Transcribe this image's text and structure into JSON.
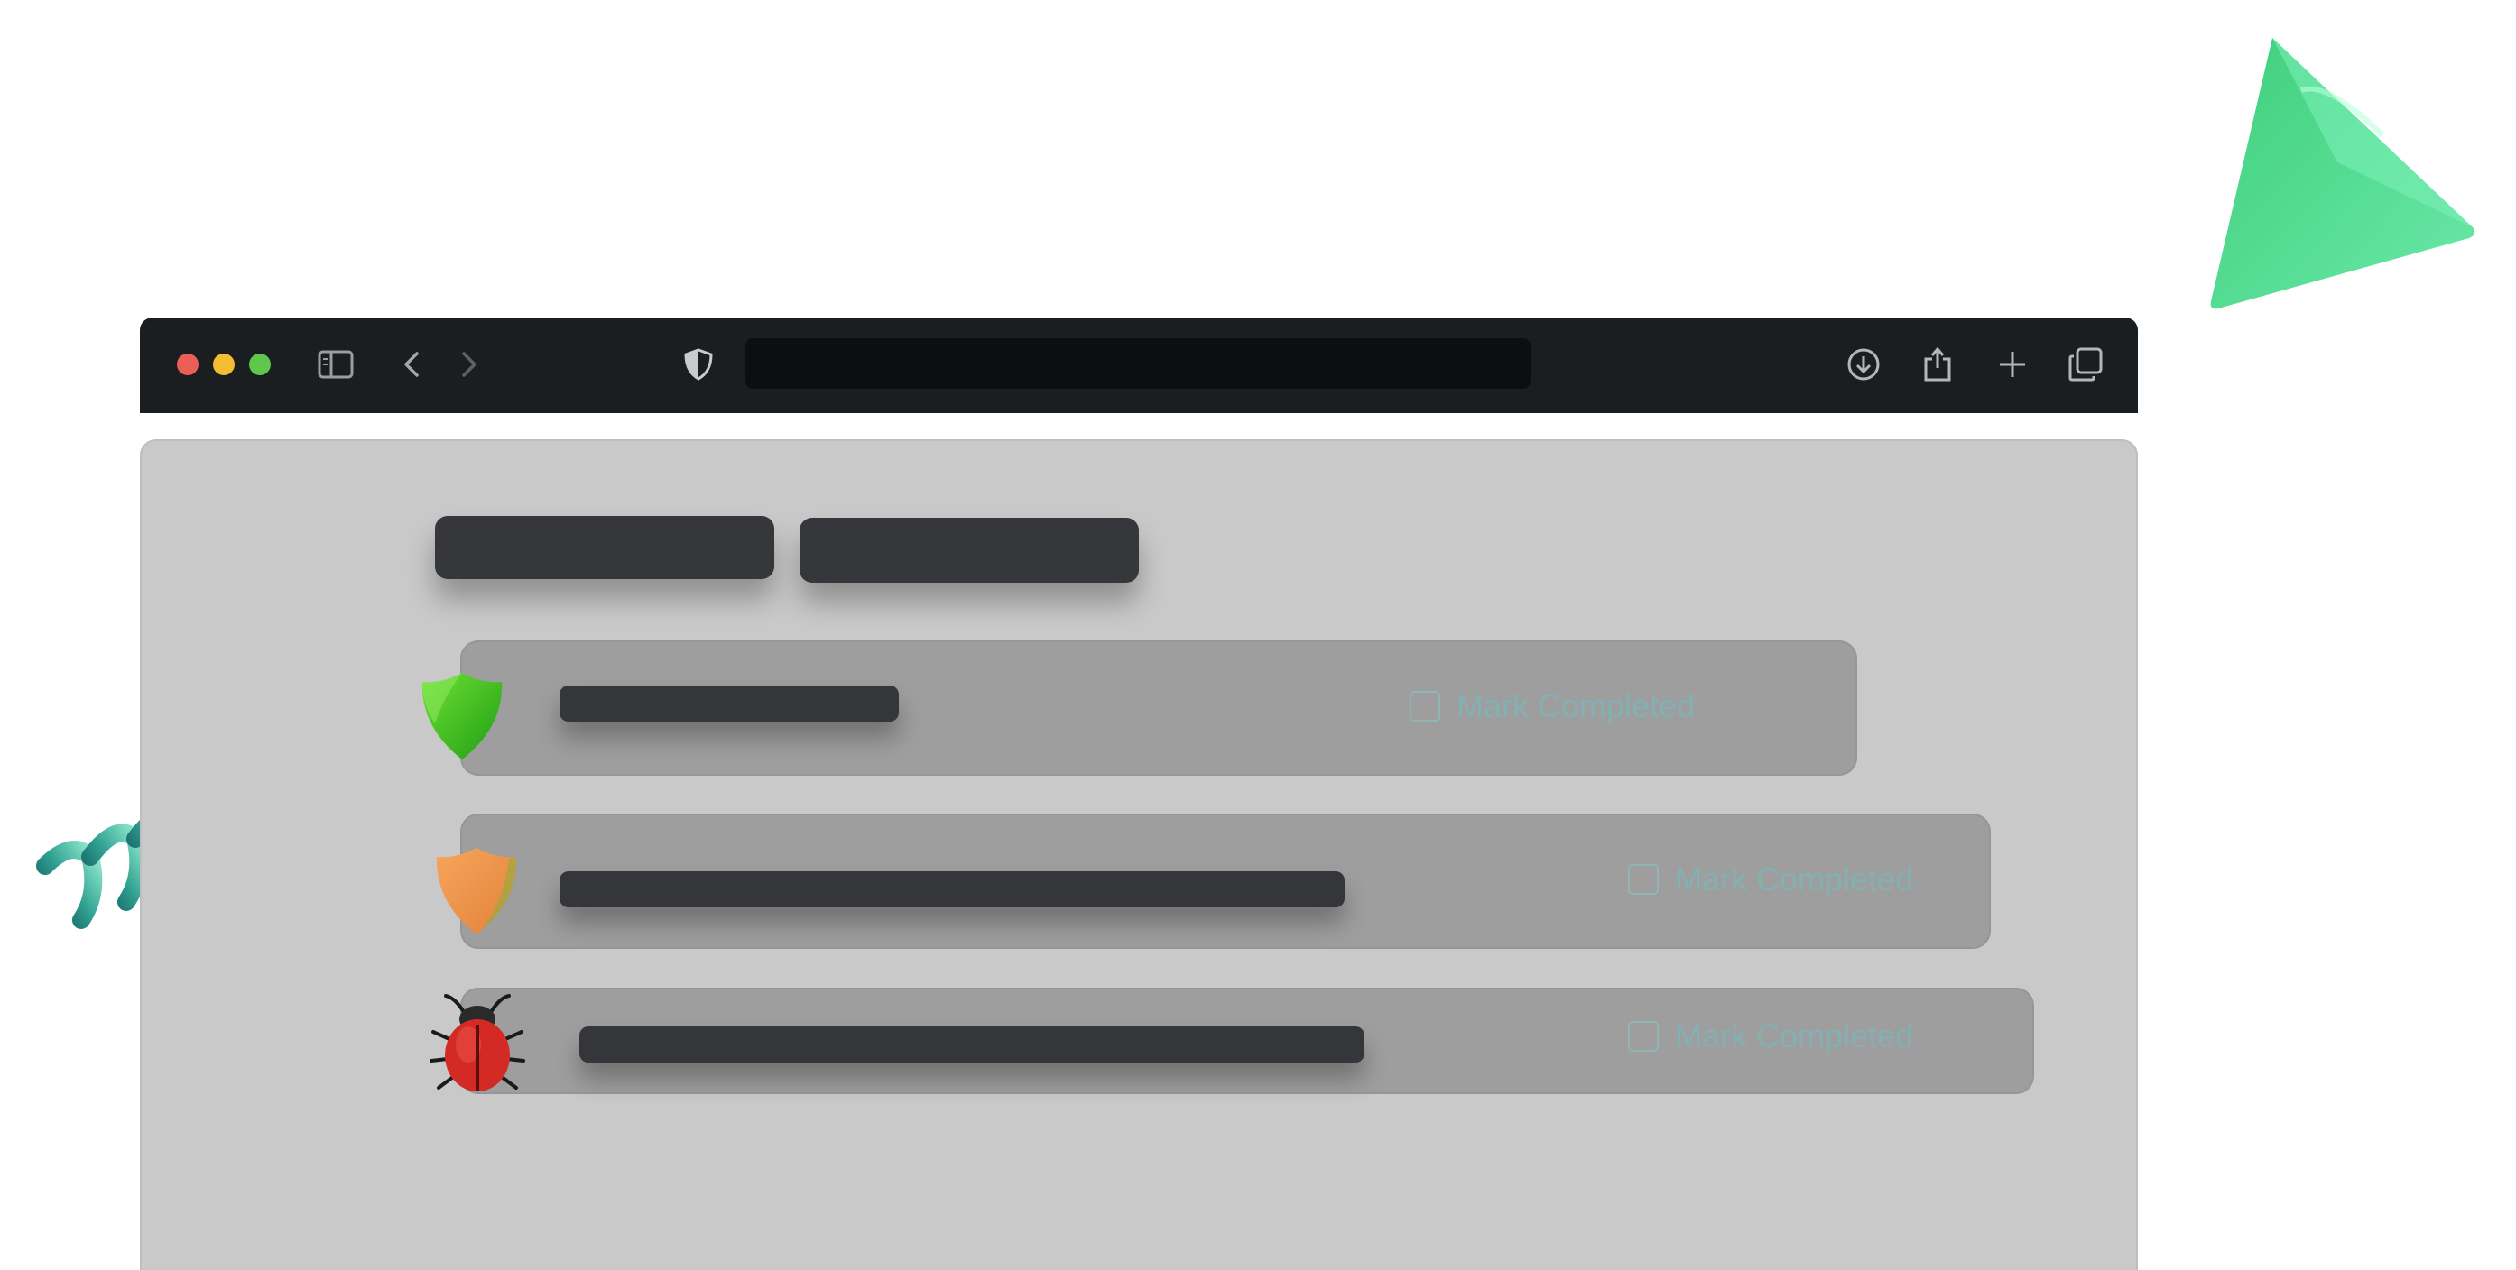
{
  "tasks": [
    {
      "icon": "green-shield-icon",
      "action_label": "Mark Completed"
    },
    {
      "icon": "orange-shield-icon",
      "action_label": "Mark Completed"
    },
    {
      "icon": "ladybug-icon",
      "action_label": "Mark Completed"
    }
  ],
  "colors": {
    "toolbar": "#1b1e21",
    "content_bg": "#c8c9c8",
    "row_bg": "#9d9e9d",
    "skeleton": "#35373b",
    "action_text": "#7fb5b7",
    "close": "#ec5f57",
    "minimize": "#f4bd31",
    "zoom": "#5fc84c"
  }
}
